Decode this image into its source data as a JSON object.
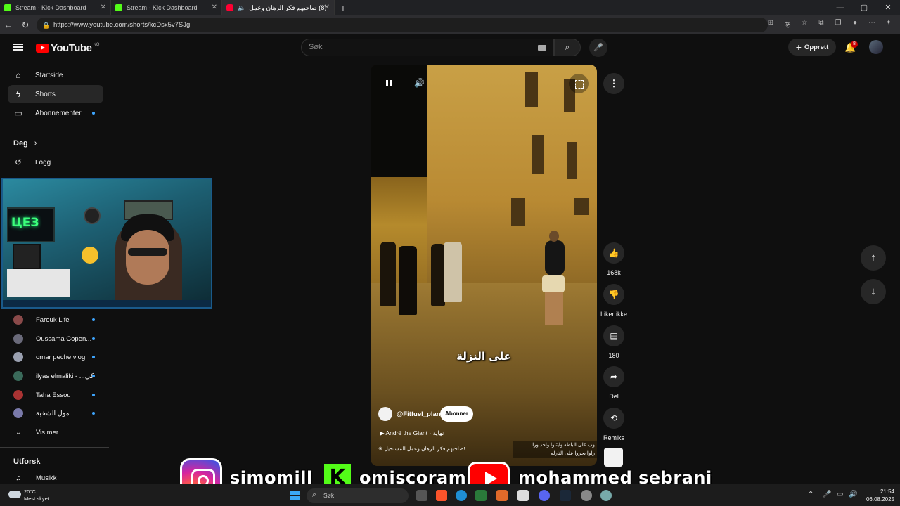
{
  "browser": {
    "tabs": [
      {
        "title": "Stream - Kick Dashboard",
        "favicon": "kick-icon"
      },
      {
        "title": "Stream - Kick Dashboard",
        "favicon": "kick-icon"
      },
      {
        "title": "(8) صاحبهم فكر الرهان وعمل",
        "favicon": "youtube-icon",
        "active": true
      }
    ],
    "url": "https://www.youtube.com/shorts/kcDsx5v7SJg",
    "window_controls": [
      "—",
      "▢",
      "✕"
    ]
  },
  "youtube": {
    "logo_text": "YouTube",
    "country_code": "NO",
    "search_placeholder": "Søk",
    "create_label": "Opprett",
    "notification_count": "8"
  },
  "sidebar": {
    "main": [
      {
        "label": "Startside",
        "icon": "home-icon"
      },
      {
        "label": "Shorts",
        "icon": "shorts-icon",
        "active": true
      },
      {
        "label": "Abonnementer",
        "icon": "subscriptions-icon",
        "dot": true
      }
    ],
    "you_heading": "Deg",
    "history_label": "Logg",
    "subscriptions": [
      {
        "name": "Farouk Life",
        "color": "#8a4a4a"
      },
      {
        "name": "Oussama Copen...",
        "color": "#6a6a7a"
      },
      {
        "name": "omar peche vlog",
        "color": "#9aa0b0"
      },
      {
        "name": "ilyas elmaliki - ...كي",
        "color": "#3a6a5a"
      },
      {
        "name": "Taha Essou",
        "color": "#aa3333"
      },
      {
        "name": "مول الشخبة",
        "color": "#7a7aaa"
      }
    ],
    "show_more": "Vis mer",
    "explore_heading": "Utforsk",
    "music_label": "Musikk"
  },
  "video": {
    "caption": "على النزلة",
    "channel": "@Fitfuel_plan",
    "subscribe_label": "Abonner",
    "music": "André the Giant · نهاية",
    "title": "صاحبهم فكر الرهان وعمل المستحيل!",
    "overlay_text_1": "وب على الباطه وايثنوا واحد ورا",
    "overlay_text_2": "زلوا يجروا على النازله"
  },
  "actions": {
    "likes": "168k",
    "dislike_label": "Liker ikke",
    "comments": "180",
    "share_label": "Del",
    "remix_label": "Remiks"
  },
  "banner": {
    "instagram": "simomill",
    "kick": "omiscoram",
    "youtube": "mohammed sebrani"
  },
  "taskbar": {
    "temperature": "20°C",
    "weather": "Mest skyet",
    "search_placeholder": "Søk",
    "time": "21:54",
    "date": "06.08.2025"
  }
}
